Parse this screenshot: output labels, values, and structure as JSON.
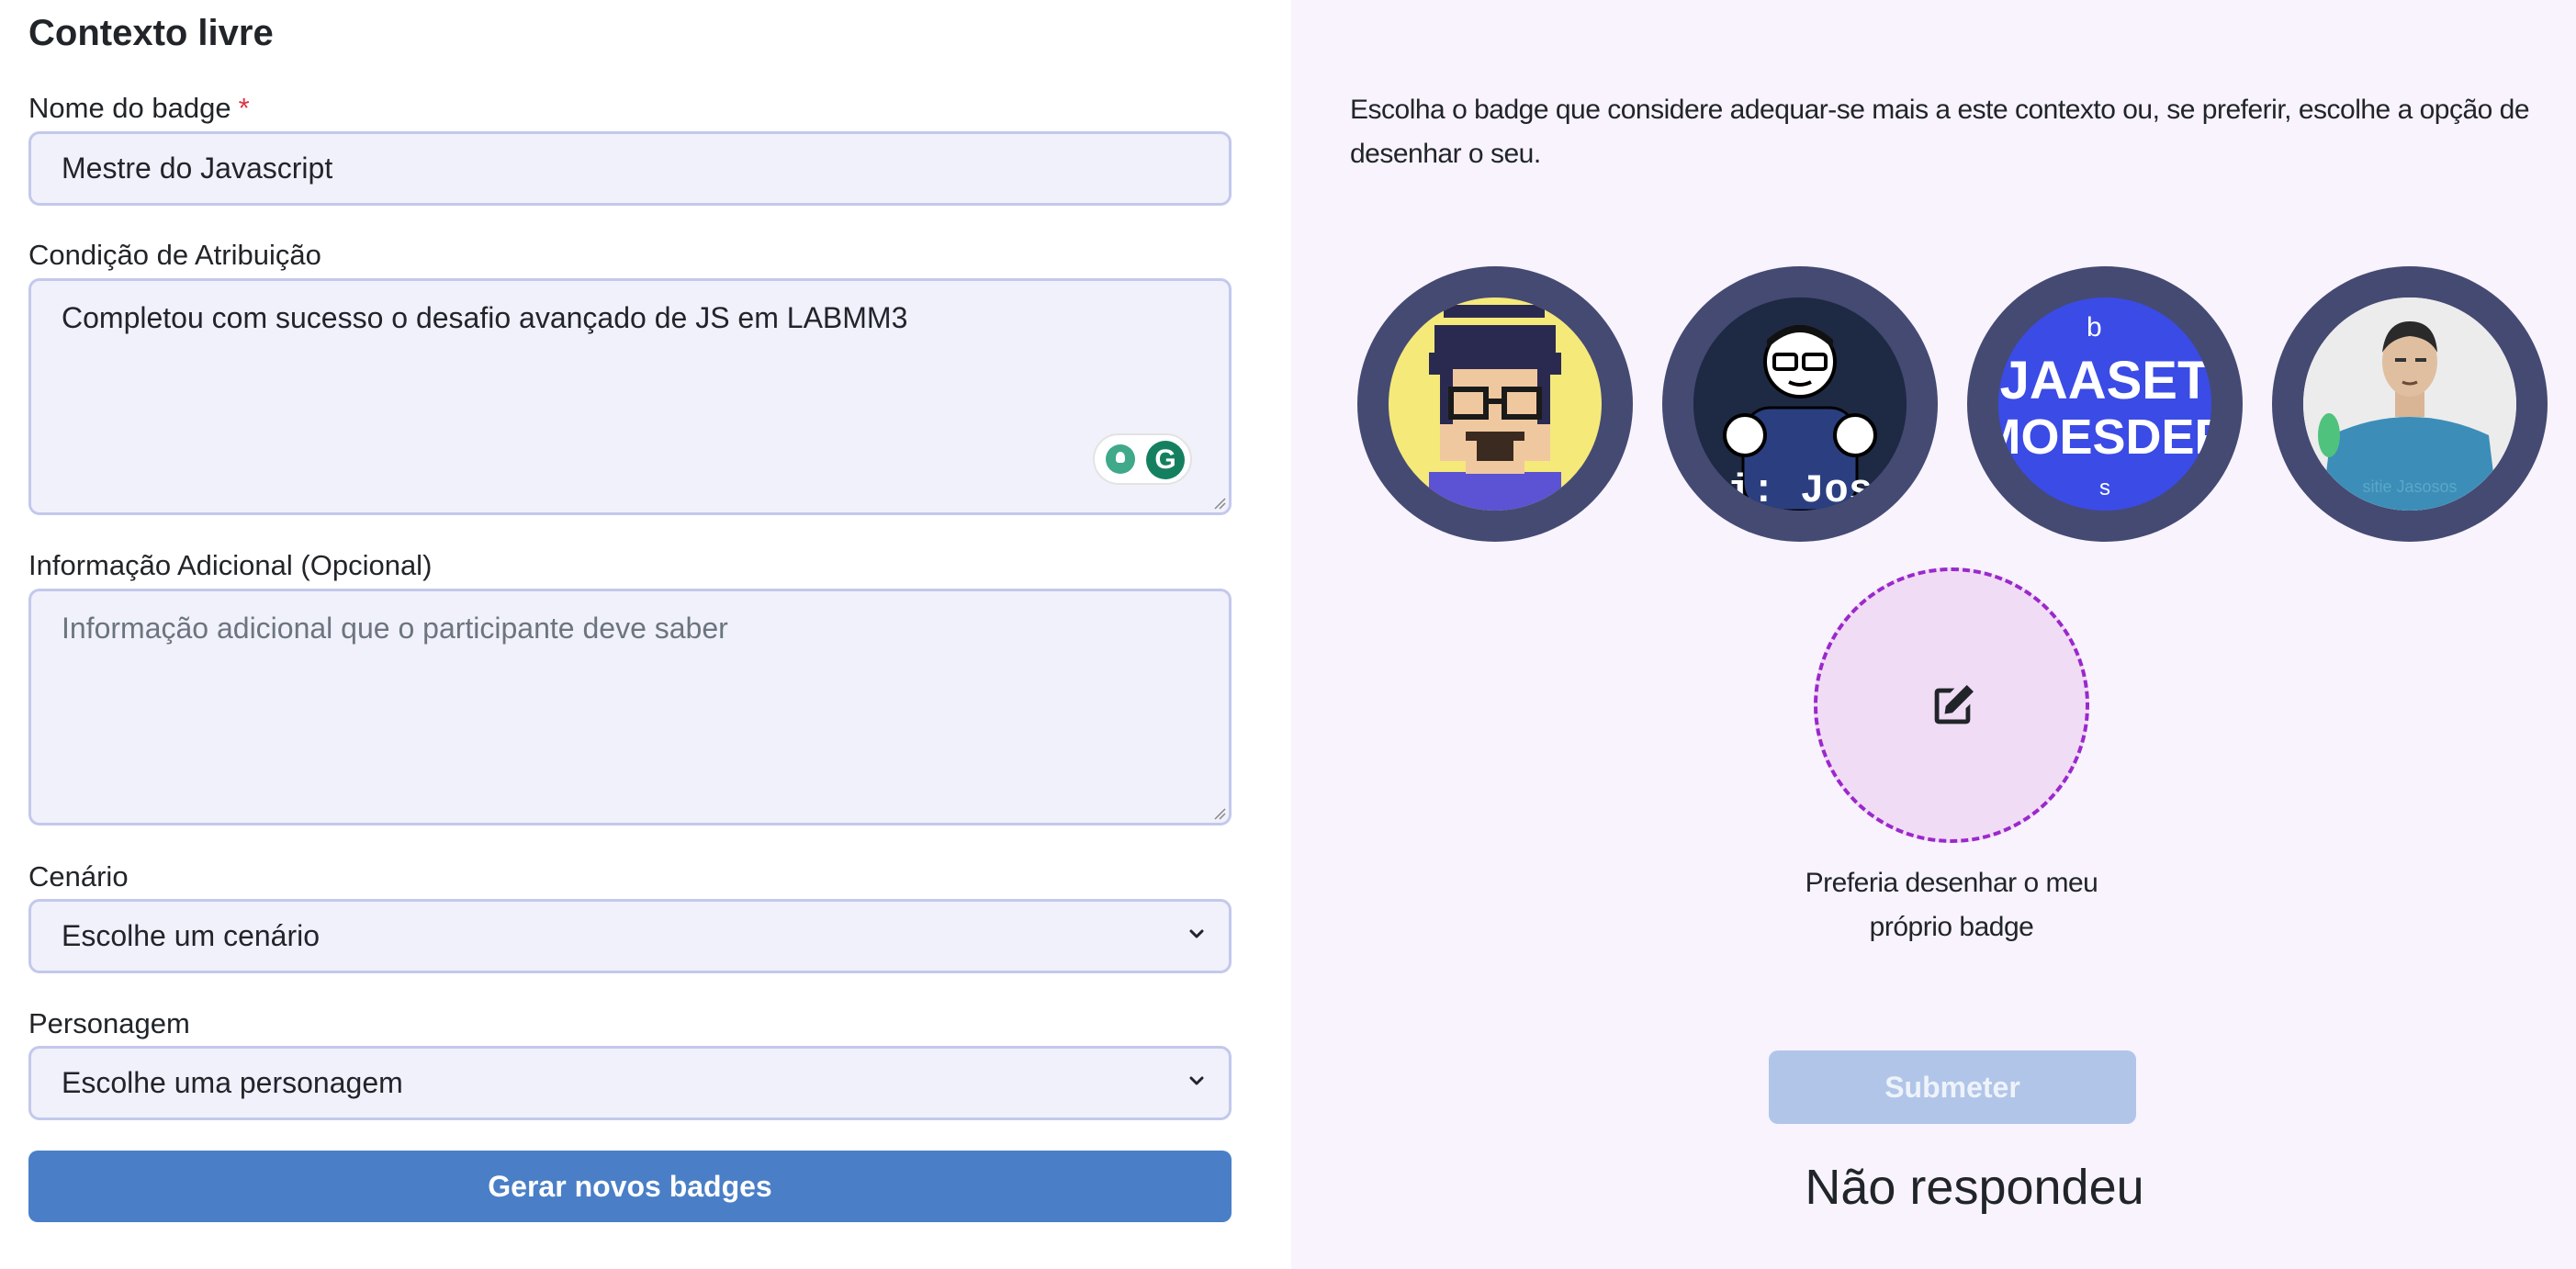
{
  "form": {
    "title": "Contexto livre",
    "badge_name": {
      "label": "Nome do badge",
      "required_mark": "*",
      "value": "Mestre do Javascript"
    },
    "condition": {
      "label": "Condição de Atribuição",
      "value": "Completou com sucesso o desafio avançado de JS em LABMM3"
    },
    "additional_info": {
      "label": "Informação Adicional (Opcional)",
      "placeholder": "Informação adicional que o participante deve saber"
    },
    "scenario": {
      "label": "Cenário",
      "selected": "Escolhe um cenário"
    },
    "character": {
      "label": "Personagem",
      "selected": "Escolhe uma personagem"
    },
    "generate_button": "Gerar novos badges"
  },
  "grammarly": {
    "logo_letter": "G"
  },
  "badge_panel": {
    "instructions": "Escolha o badge que considere adequar-se mais a este contexto ou, se preferir, escolhe a opção de desenhar o seu.",
    "badges": [
      {
        "name": "pixel-art-glasses-man",
        "caption": ""
      },
      {
        "name": "cartoon-glasses-man",
        "caption": "ui: Joss"
      },
      {
        "name": "text-badge",
        "caption_top": "JAASET",
        "caption_bottom": "MOESDER",
        "mark_top": "b",
        "mark_bottom": "s"
      },
      {
        "name": "realistic-man",
        "caption": "sitie Jasosos"
      }
    ],
    "draw_own_label": "Preferia desenhar o meu próprio badge",
    "submit_button": "Submeter",
    "status": "Não respondeu"
  },
  "colors": {
    "accent_blue": "#4a7fc7",
    "submit_disabled": "#b1c5e8",
    "badge_ring": "#454a73",
    "dashed_border": "#9b28cc",
    "panel_bg": "#f8f3fc"
  }
}
